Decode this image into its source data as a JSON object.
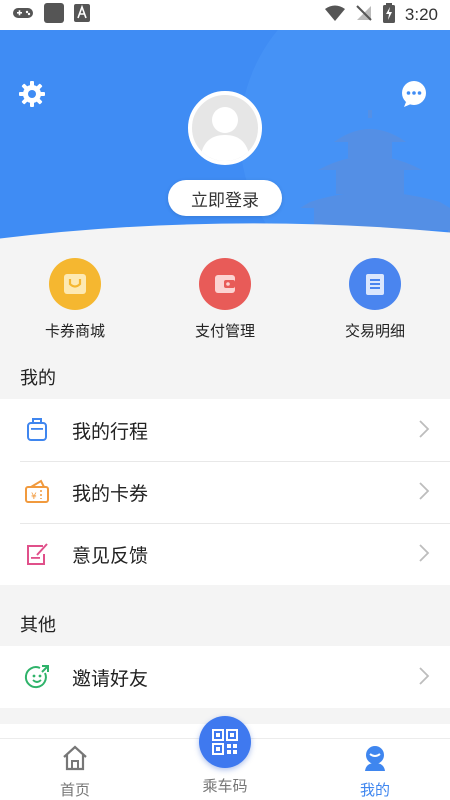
{
  "status_bar": {
    "time": "3:20"
  },
  "header": {
    "login_label": "立即登录"
  },
  "quick_actions": [
    {
      "label": "卡券商城",
      "icon": "shopping-bag-icon",
      "color": "#f5b730"
    },
    {
      "label": "支付管理",
      "icon": "wallet-icon",
      "color": "#e85b58"
    },
    {
      "label": "交易明细",
      "icon": "document-list-icon",
      "color": "#4a85ef"
    }
  ],
  "my_section": {
    "title": "我的",
    "items": [
      {
        "label": "我的行程",
        "icon": "luggage-icon"
      },
      {
        "label": "我的卡券",
        "icon": "coupon-icon"
      },
      {
        "label": "意见反馈",
        "icon": "feedback-edit-icon"
      }
    ]
  },
  "other_section": {
    "title": "其他",
    "items": [
      {
        "label": "邀请好友",
        "icon": "invite-smile-icon"
      }
    ]
  },
  "bottom_nav": [
    {
      "label": "首页",
      "icon": "home-icon",
      "active": false
    },
    {
      "label": "乘车码",
      "icon": "qr-code-icon",
      "active": false
    },
    {
      "label": "我的",
      "icon": "profile-icon",
      "active": true
    }
  ],
  "colors": {
    "primary": "#3f8cf4",
    "active_nav": "#3f86ef"
  }
}
